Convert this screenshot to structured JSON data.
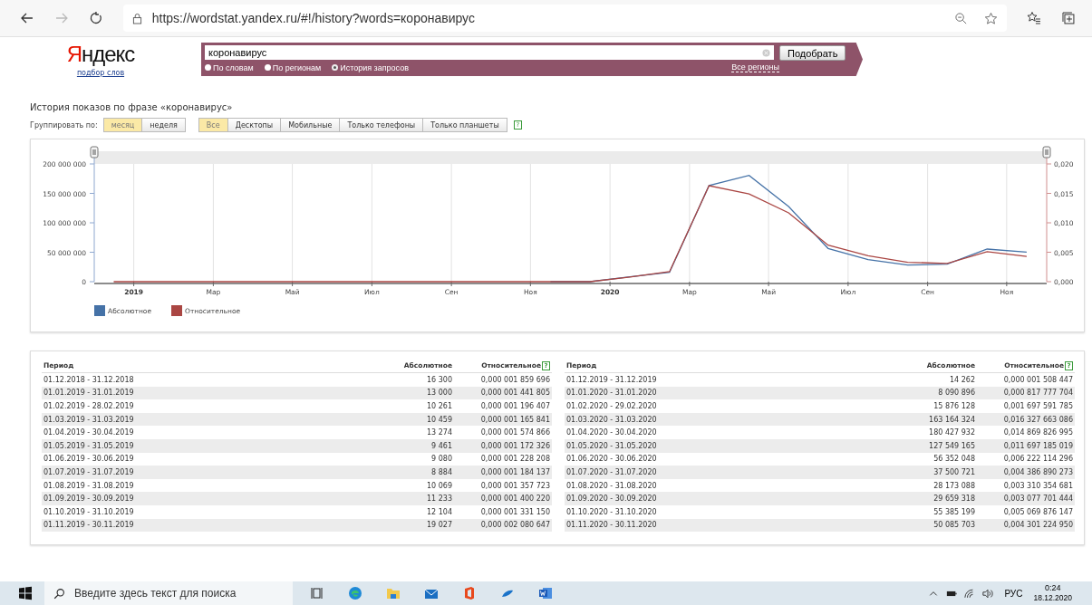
{
  "browser": {
    "url": "https://wordstat.yandex.ru/#!/history?words=коронавирус"
  },
  "header": {
    "logo": "Яндекс",
    "logo_link": "подбор слов",
    "query": "коронавирус",
    "search_button": "Подобрать",
    "regions_link": "Все регионы",
    "modes": [
      {
        "label": "По словам",
        "selected": false
      },
      {
        "label": "По регионам",
        "selected": false
      },
      {
        "label": "История запросов",
        "selected": true
      }
    ]
  },
  "title": "История показов по фразе «коронавирус»",
  "grouping": {
    "label": "Группировать по:",
    "help": "?",
    "periods": [
      {
        "label": "месяц",
        "selected": true
      },
      {
        "label": "неделя",
        "selected": false
      }
    ],
    "devices": [
      {
        "label": "Все",
        "selected": true
      },
      {
        "label": "Десктопы",
        "selected": false
      },
      {
        "label": "Мобильные",
        "selected": false
      },
      {
        "label": "Только телефоны",
        "selected": false
      },
      {
        "label": "Только планшеты",
        "selected": false
      }
    ]
  },
  "chart": {
    "chart_data": {
      "type": "line",
      "grid": true,
      "x": [
        2018.958,
        2019.042,
        2019.125,
        2019.208,
        2019.292,
        2019.375,
        2019.458,
        2019.542,
        2019.625,
        2019.708,
        2019.792,
        2019.875,
        2019.958,
        2020.042,
        2020.125,
        2020.208,
        2020.292,
        2020.375,
        2020.458,
        2020.542,
        2020.625,
        2020.708,
        2020.792,
        2020.875
      ],
      "xlim": [
        2018.917,
        2020.917
      ],
      "ylim": [
        0,
        200000000
      ],
      "xticks": [
        2019,
        {
          "value": 2019.167,
          "label": "Мар"
        },
        {
          "value": 2019.333,
          "label": "Май"
        },
        {
          "value": 2019.5,
          "label": "Июл"
        },
        {
          "value": 2019.667,
          "label": "Сен"
        },
        {
          "value": 2019.833,
          "label": "Ноя"
        },
        2020,
        {
          "value": 2020.167,
          "label": "Мар"
        },
        {
          "value": 2020.333,
          "label": "Май"
        },
        {
          "value": 2020.5,
          "label": "Июл"
        },
        {
          "value": 2020.667,
          "label": "Сен"
        },
        {
          "value": 2020.833,
          "label": "Ноя"
        }
      ],
      "yticks": [
        {
          "value": 0,
          "label": "0"
        },
        {
          "value": 50000000,
          "label": "50 000 000"
        },
        {
          "value": 100000000,
          "label": "100 000 000"
        },
        {
          "value": 150000000,
          "label": "150 000 000"
        },
        {
          "value": 200000000,
          "label": "200 000 000"
        }
      ],
      "y2lim": [
        0,
        0.02
      ],
      "y2ticks": [
        {
          "value": 0,
          "label": "0,000"
        },
        {
          "value": 0.005,
          "label": "0,005"
        },
        {
          "value": 0.01,
          "label": "0,010"
        },
        {
          "value": 0.015,
          "label": "0,015"
        },
        {
          "value": 0.02,
          "label": "0,020"
        }
      ],
      "series": [
        {
          "name": "Абсолютное",
          "color": "#4572a7",
          "values": [
            null,
            null,
            null,
            null,
            null,
            null,
            null,
            null,
            null,
            null,
            null,
            0,
            0,
            8100000,
            15900000,
            163200000,
            180400000,
            127500000,
            56400000,
            37500000,
            28200000,
            29700000,
            55400000,
            50100000
          ]
        },
        {
          "name": "Относительное",
          "color": "#aa4643",
          "axis": "y2",
          "values": [
            0,
            0,
            0,
            0,
            0,
            0,
            0,
            0,
            0,
            0,
            0,
            0,
            0,
            0.0008,
            0.0017,
            0.0163,
            0.0149,
            0.0117,
            0.0062,
            0.0044,
            0.0033,
            0.0031,
            0.0051,
            0.0043
          ]
        }
      ]
    }
  },
  "table": {
    "halves": [
      {
        "columns": [
          "Период",
          "Абсолютное",
          "Относительное"
        ],
        "help": "?",
        "rows": [
          [
            "01.12.2018 - 31.12.2018",
            "16 300",
            "0,000 001 859 696"
          ],
          [
            "01.01.2019 - 31.01.2019",
            "13 000",
            "0,000 001 441 805"
          ],
          [
            "01.02.2019 - 28.02.2019",
            "10 261",
            "0,000 001 196 407"
          ],
          [
            "01.03.2019 - 31.03.2019",
            "10 459",
            "0,000 001 165 841"
          ],
          [
            "01.04.2019 - 30.04.2019",
            "13 274",
            "0,000 001 574 866"
          ],
          [
            "01.05.2019 - 31.05.2019",
            "9 461",
            "0,000 001 172 326"
          ],
          [
            "01.06.2019 - 30.06.2019",
            "9 080",
            "0,000 001 228 208"
          ],
          [
            "01.07.2019 - 31.07.2019",
            "8 884",
            "0,000 001 184 137"
          ],
          [
            "01.08.2019 - 31.08.2019",
            "10 069",
            "0,000 001 357 723"
          ],
          [
            "01.09.2019 - 30.09.2019",
            "11 233",
            "0,000 001 400 220"
          ],
          [
            "01.10.2019 - 31.10.2019",
            "12 104",
            "0,000 001 331 150"
          ],
          [
            "01.11.2019 - 30.11.2019",
            "19 027",
            "0,000 002 080 647"
          ]
        ]
      },
      {
        "columns": [
          "Период",
          "Абсолютное",
          "Относительное"
        ],
        "help": "?",
        "rows": [
          [
            "01.12.2019 - 31.12.2019",
            "14 262",
            "0,000 001 508 447"
          ],
          [
            "01.01.2020 - 31.01.2020",
            "8 090 896",
            "0,000 817 777 704"
          ],
          [
            "01.02.2020 - 29.02.2020",
            "15 876 128",
            "0,001 697 591 785"
          ],
          [
            "01.03.2020 - 31.03.2020",
            "163 164 324",
            "0,016 327 663 086"
          ],
          [
            "01.04.2020 - 30.04.2020",
            "180 427 932",
            "0,014 869 826 995"
          ],
          [
            "01.05.2020 - 31.05.2020",
            "127 549 165",
            "0,011 697 185 019"
          ],
          [
            "01.06.2020 - 30.06.2020",
            "56 352 048",
            "0,006 222 114 296"
          ],
          [
            "01.07.2020 - 31.07.2020",
            "37 500 721",
            "0,004 386 890 273"
          ],
          [
            "01.08.2020 - 31.08.2020",
            "28 173 088",
            "0,003 310 354 681"
          ],
          [
            "01.09.2020 - 30.09.2020",
            "29 659 318",
            "0,003 077 701 444"
          ],
          [
            "01.10.2020 - 31.10.2020",
            "55 385 199",
            "0,005 069 876 147"
          ],
          [
            "01.11.2020 - 30.11.2020",
            "50 085 703",
            "0,004 301 224 950"
          ]
        ]
      }
    ]
  },
  "taskbar": {
    "search_placeholder": "Введите здесь текст для поиска",
    "language": "РУС",
    "time": "0:24",
    "date": "18.12.2020"
  }
}
